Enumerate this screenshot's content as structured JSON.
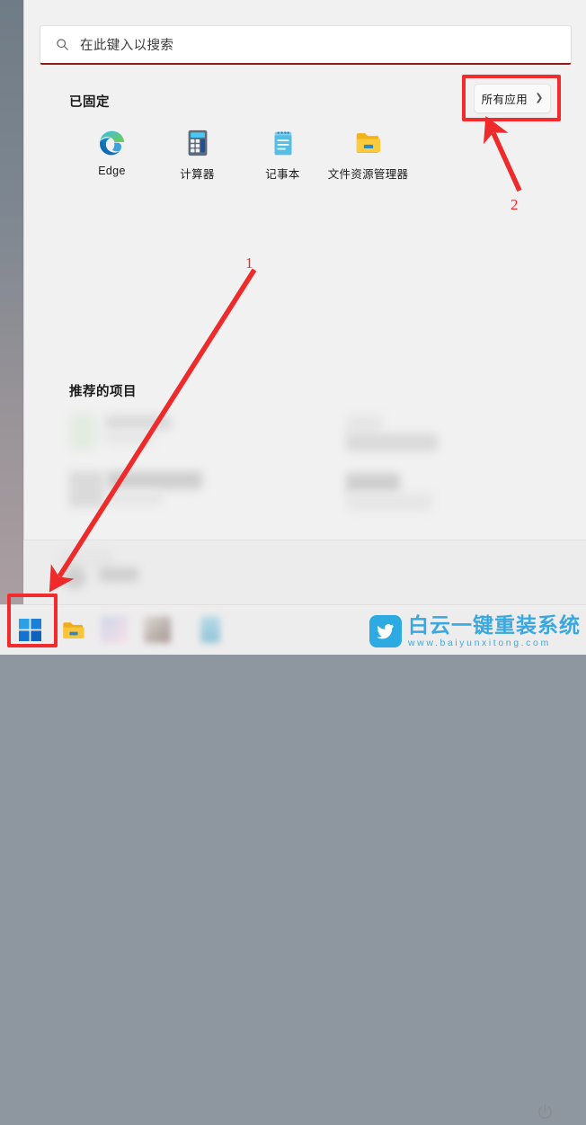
{
  "window": {
    "name": "windows-11-start-menu"
  },
  "search": {
    "placeholder": "在此键入以搜索",
    "icon": "search-icon",
    "value": ""
  },
  "pinned": {
    "title": "已固定",
    "all_apps": {
      "label": "所有应用",
      "chevron": "chevron-right-icon"
    },
    "apps": [
      {
        "label": "Edge",
        "icon": "edge-icon"
      },
      {
        "label": "计算器",
        "icon": "calculator-icon"
      },
      {
        "label": "记事本",
        "icon": "notepad-icon"
      },
      {
        "label": "文件资源管理器",
        "icon": "file-explorer-icon"
      }
    ]
  },
  "recommended": {
    "title": "推荐的项目",
    "items": [
      {
        "label": "",
        "sublabel": "",
        "redacted": true
      },
      {
        "label": "",
        "sublabel": "",
        "redacted": true
      },
      {
        "label": "",
        "sublabel": "",
        "redacted": true
      },
      {
        "label": "",
        "sublabel": "",
        "redacted": true
      }
    ]
  },
  "account_bar": {
    "user_name": "",
    "user_redacted": true,
    "power": {
      "icon": "power-icon",
      "label": ""
    }
  },
  "taskbar": {
    "items": [
      {
        "name": "start-button",
        "icon": "windows-logo-icon"
      },
      {
        "name": "file-explorer-button",
        "icon": "folder-icon"
      },
      {
        "name": "pinned-app-3",
        "icon": "app-icon-blurred"
      },
      {
        "name": "pinned-app-4",
        "icon": "app-icon-blurred"
      },
      {
        "name": "pinned-app-5",
        "icon": "app-icon-blurred"
      }
    ]
  },
  "annotations": {
    "color": "#ee2a2a",
    "markers": [
      {
        "number": "1",
        "target": "start-button",
        "description": "arrow pointing to taskbar start button"
      },
      {
        "number": "2",
        "target": "all-apps-button",
        "description": "arrow pointing to all apps button"
      }
    ],
    "highlights": [
      {
        "target": "all-apps-button",
        "color": "#f22c2c"
      },
      {
        "target": "start-button",
        "color": "#f22c2c"
      }
    ]
  },
  "watermark": {
    "title": "白云一键重装系统",
    "url": "www.baiyunxitong.com",
    "logo": "bird-logo-icon",
    "color": "#39a8e0"
  }
}
